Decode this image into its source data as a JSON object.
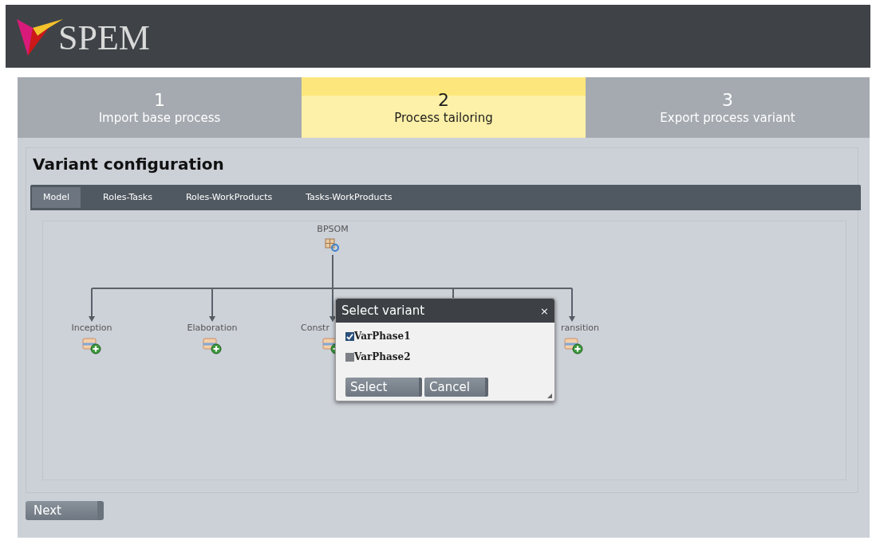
{
  "header": {
    "logo_text": "SPEM"
  },
  "steps": [
    {
      "number": "1",
      "label": "Import base process",
      "selected": false
    },
    {
      "number": "2",
      "label": "Process tailoring",
      "selected": true
    },
    {
      "number": "3",
      "label": "Export process variant",
      "selected": false
    }
  ],
  "section_title": "Variant configuration",
  "tabs": [
    {
      "label": "Model",
      "selected": true
    },
    {
      "label": "Roles-Tasks",
      "selected": false
    },
    {
      "label": "Roles-WorkProducts",
      "selected": false
    },
    {
      "label": "Tasks-WorkProducts",
      "selected": false
    }
  ],
  "diagram": {
    "root": {
      "label": "BPSOM"
    },
    "phases": [
      {
        "label": "Inception"
      },
      {
        "label": "Elaboration"
      },
      {
        "label": "Constr"
      },
      {
        "label": "ransition"
      }
    ]
  },
  "dialog": {
    "title": "Select variant",
    "close": "×",
    "options": [
      {
        "label": "VarPhase1",
        "checked": true
      },
      {
        "label": "VarPhase2",
        "checked": false
      }
    ],
    "buttons": [
      "Select",
      "Cancel"
    ]
  },
  "next_button": "Next"
}
